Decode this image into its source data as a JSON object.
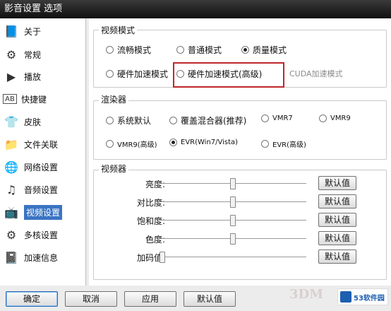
{
  "window": {
    "title": "影音设置 选项"
  },
  "sidebar": {
    "items": [
      {
        "label": "关于",
        "icon": "info-book-icon"
      },
      {
        "label": "常规",
        "icon": "gear-icon"
      },
      {
        "label": "播放",
        "icon": "play-icon"
      },
      {
        "label": "快捷键",
        "icon": "keyboard-ab-icon"
      },
      {
        "label": "皮肤",
        "icon": "shirt-icon"
      },
      {
        "label": "文件关联",
        "icon": "folder-icon"
      },
      {
        "label": "网络设置",
        "icon": "globe-icon"
      },
      {
        "label": "音频设置",
        "icon": "audio-icon"
      },
      {
        "label": "视频设置",
        "icon": "tv-icon",
        "selected": true
      },
      {
        "label": "多核设置",
        "icon": "multicore-icon"
      },
      {
        "label": "加速信息",
        "icon": "book-icon"
      }
    ]
  },
  "video_mode": {
    "title": "视频模式",
    "options": [
      {
        "label": "流畅模式",
        "checked": false
      },
      {
        "label": "普通模式",
        "checked": false
      },
      {
        "label": "质量模式",
        "checked": true
      },
      {
        "label": "硬件加速模式",
        "checked": false
      },
      {
        "label": "硬件加速模式(高级)",
        "checked": false
      }
    ],
    "cuda_label": "CUDA加速模式"
  },
  "renderer": {
    "title": "渲染器",
    "options": [
      {
        "label": "系统默认",
        "checked": false
      },
      {
        "label": "覆盖混合器(推荐)",
        "checked": false
      },
      {
        "label": "VMR7",
        "checked": false
      },
      {
        "label": "VMR9",
        "checked": false
      },
      {
        "label": "VMR9(高级)",
        "checked": false
      },
      {
        "label": "EVR(Win7/Vista)",
        "checked": true
      },
      {
        "label": "EVR(高级)",
        "checked": false
      }
    ]
  },
  "video_adjust": {
    "title": "视频器",
    "rows": [
      {
        "label": "亮度:",
        "value_fraction": 0.5,
        "button": "默认值"
      },
      {
        "label": "对比度:",
        "value_fraction": 0.5,
        "button": "默认值"
      },
      {
        "label": "饱和度:",
        "value_fraction": 0.5,
        "button": "默认值"
      },
      {
        "label": "色度:",
        "value_fraction": 0.5,
        "button": "默认值"
      },
      {
        "label": "加码值:",
        "value_fraction": 0.0,
        "button": "默认值"
      }
    ]
  },
  "buttons": {
    "ok": "确定",
    "cancel": "取消",
    "apply": "应用",
    "default": "默认值"
  },
  "watermarks": {
    "site_3dm": "3DM",
    "site_53": "53软件园"
  },
  "colors": {
    "selection": "#3a74c4",
    "highlight_box": "#c0262c"
  }
}
